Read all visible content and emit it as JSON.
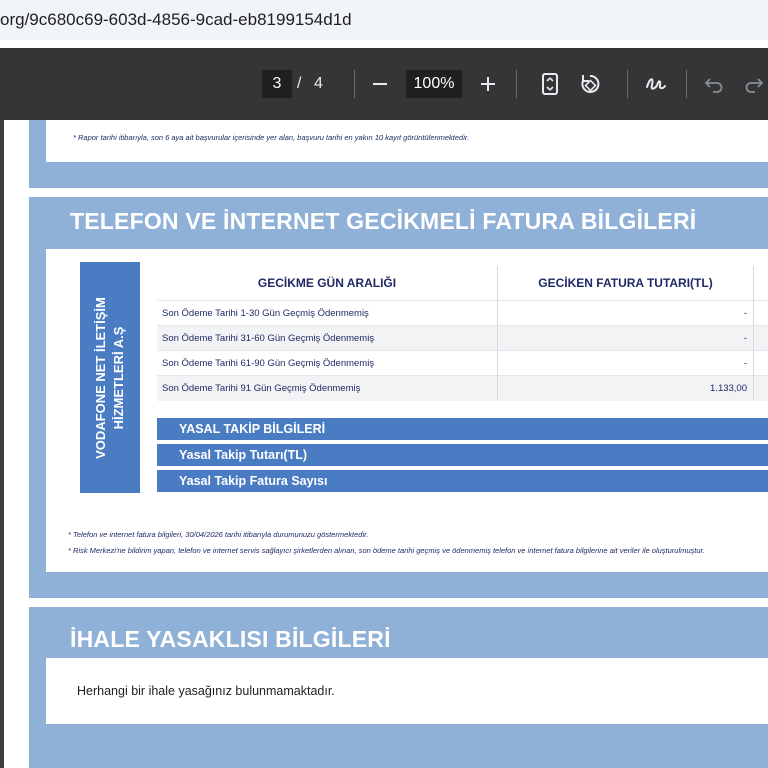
{
  "browser": {
    "url": "org/9c680c69-603d-4856-9cad-eb8199154d1d"
  },
  "toolbar": {
    "current_page": "3",
    "page_separator": "/",
    "total_pages": "4",
    "zoom": "100%",
    "icons": [
      "minus-icon",
      "plus-icon",
      "fit-page-icon",
      "rotate-icon",
      "draw-icon",
      "undo-icon",
      "redo-icon"
    ]
  },
  "document": {
    "top_footnote": "* Rapor tarihi itibarıyla, son 6 aya ait başvurular içerisinde yer alan, başvuru tarihi en yakın 10 kayıt görüntülenmektedir.",
    "late_bills_section": {
      "title": "TELEFON VE İNTERNET GECİKMELİ FATURA BİLGİLERİ",
      "provider_label": "VODAFONE NET İLETİŞİM HİZMETLERİ A.Ş",
      "columns": [
        "GECİKME GÜN ARALIĞI",
        "GECİKEN FATURA TUTARI(TL)"
      ],
      "rows": [
        {
          "range": "Son Ödeme Tarihi 1-30 Gün Geçmiş Ödenmemiş",
          "amount": "-"
        },
        {
          "range": "Son Ödeme Tarihi 31-60 Gün Geçmiş Ödenmemiş",
          "amount": "-"
        },
        {
          "range": "Son Ödeme Tarihi 61-90 Gün Geçmiş Ödenmemiş",
          "amount": "-"
        },
        {
          "range": "Son Ödeme Tarihi 91 Gün Geçmiş Ödenmemiş",
          "amount": "1.133,00"
        }
      ],
      "legal_follow_up": {
        "header": "YASAL TAKİP BİLGİLERİ",
        "amount_label": "Yasal Takip Tutarı(TL)",
        "bill_count_label": "Yasal Takip Fatura Sayısı"
      },
      "footnote_1": "* Telefon ve internet fatura bilgileri, 30/04/2026 tarihi itibarıyla durumunuzu göstermektedir.",
      "footnote_2": "* Risk Merkezi'ne bildirim yapan, telefon ve internet servis sağlayıcı şirketlerden alınan, son ödeme tarihi geçmiş ve ödenmemiş telefon ve internet fatura bilgilerine ait veriler ile oluşturulmuştur."
    },
    "tender_ban_section": {
      "title": "İHALE YASAKLISI BİLGİLERİ",
      "message": "Herhangi bir ihale yasağınız bulunmamaktadır."
    }
  },
  "colors": {
    "toolbar_bg": "#333537",
    "panel_blue": "#8fb1d8",
    "header_blue": "#4a7cc4",
    "text_navy": "#1f2a66"
  }
}
